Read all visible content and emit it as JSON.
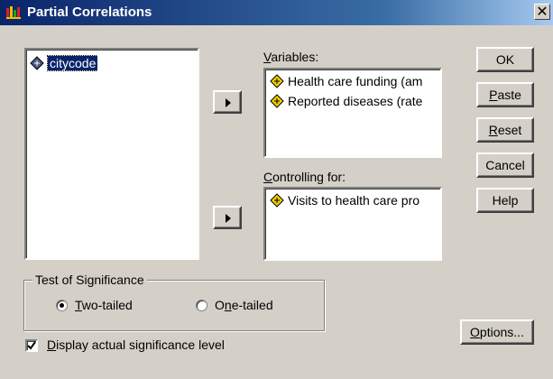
{
  "window": {
    "title": "Partial Correlations",
    "close_glyph": "✕"
  },
  "source_list": {
    "items": [
      {
        "label": "citycode",
        "icon": "scale-variable-icon",
        "selected": true
      }
    ]
  },
  "variables": {
    "label": "Variables:",
    "items": [
      {
        "label": "Health care funding (am",
        "icon": "scale-variable-icon"
      },
      {
        "label": "Reported diseases (rate",
        "icon": "scale-variable-icon"
      }
    ]
  },
  "controlling": {
    "label": "Controlling for:",
    "items": [
      {
        "label": "Visits to health care pro",
        "icon": "scale-variable-icon"
      }
    ]
  },
  "buttons": {
    "ok": "OK",
    "paste": "Paste",
    "reset": "Reset",
    "cancel": "Cancel",
    "help": "Help",
    "options": "Options..."
  },
  "significance": {
    "legend": "Test of Significance",
    "two_tailed": "Two-tailed",
    "one_tailed": "One-tailed",
    "selected": "two_tailed"
  },
  "display_actual": {
    "label": "Display actual significance level",
    "checked": true
  },
  "colors": {
    "selection": "#0a246a",
    "face": "#d4d0c8",
    "variable_icon_fill": "#f0d000"
  }
}
